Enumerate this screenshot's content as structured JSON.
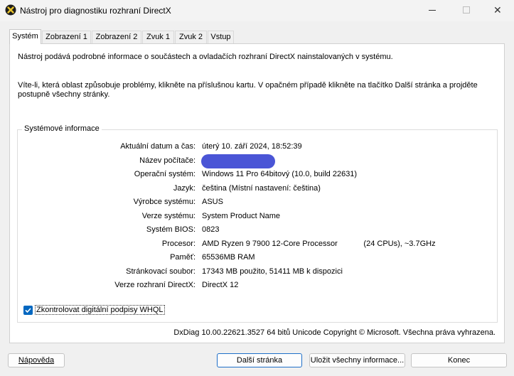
{
  "window": {
    "title": "Nástroj pro diagnostiku rozhraní DirectX",
    "icon": "directx-x-icon",
    "controls": {
      "minimize": "minimize-icon",
      "maximize": "maximize-icon",
      "close": "close-icon"
    }
  },
  "tabs": [
    {
      "label": "Systém",
      "active": true
    },
    {
      "label": "Zobrazení 1"
    },
    {
      "label": "Zobrazení 2"
    },
    {
      "label": "Zvuk 1"
    },
    {
      "label": "Zvuk 2"
    },
    {
      "label": "Vstup"
    }
  ],
  "intro": {
    "line1": "Nástroj podává podrobné informace o součástech a ovladačích rozhraní DirectX nainstalovaných v systému.",
    "line2": "Víte-li, která oblast způsobuje problémy, klikněte na příslušnou kartu. V opačném případě klikněte na tlačítko Další stránka a projděte postupně všechny stránky."
  },
  "system_info": {
    "group_title": "Systémové informace",
    "rows": [
      {
        "label": "Aktuální datum a čas:",
        "value": "úterý 10. září 2024, 18:52:39"
      },
      {
        "label": "Název počítače:",
        "value": ""
      },
      {
        "label": "Operační systém:",
        "value": "Windows 11 Pro 64bitový (10.0, build 22631)"
      },
      {
        "label": "Jazyk:",
        "value": "čeština (Místní nastavení: čeština)"
      },
      {
        "label": "Výrobce systému:",
        "value": "ASUS"
      },
      {
        "label": "Verze systému:",
        "value": "System Product Name"
      },
      {
        "label": "Systém BIOS:",
        "value": "0823"
      },
      {
        "label": "Procesor:",
        "value": "AMD Ryzen 9 7900 12-Core Processor            (24 CPUs), ~3.7GHz"
      },
      {
        "label": "Paměť:",
        "value": "65536MB RAM"
      },
      {
        "label": "Stránkovací soubor:",
        "value": "17343 MB použito, 51411 MB k dispozici"
      },
      {
        "label": "Verze rozhraní DirectX:",
        "value": "DirectX 12"
      }
    ],
    "whql_checkbox": {
      "label": "Zkontrolovat digitální podpisy WHQL",
      "checked": true
    }
  },
  "footer": "DxDiag 10.00.22621.3527 64 bitů Unicode Copyright © Microsoft. Všechna práva vyhrazena.",
  "buttons": {
    "help": "Nápověda",
    "next": "Další stránka",
    "save": "Uložit všechny informace...",
    "exit": "Konec"
  },
  "colors": {
    "accent": "#0067c0",
    "redaction": "#4a55d6"
  }
}
